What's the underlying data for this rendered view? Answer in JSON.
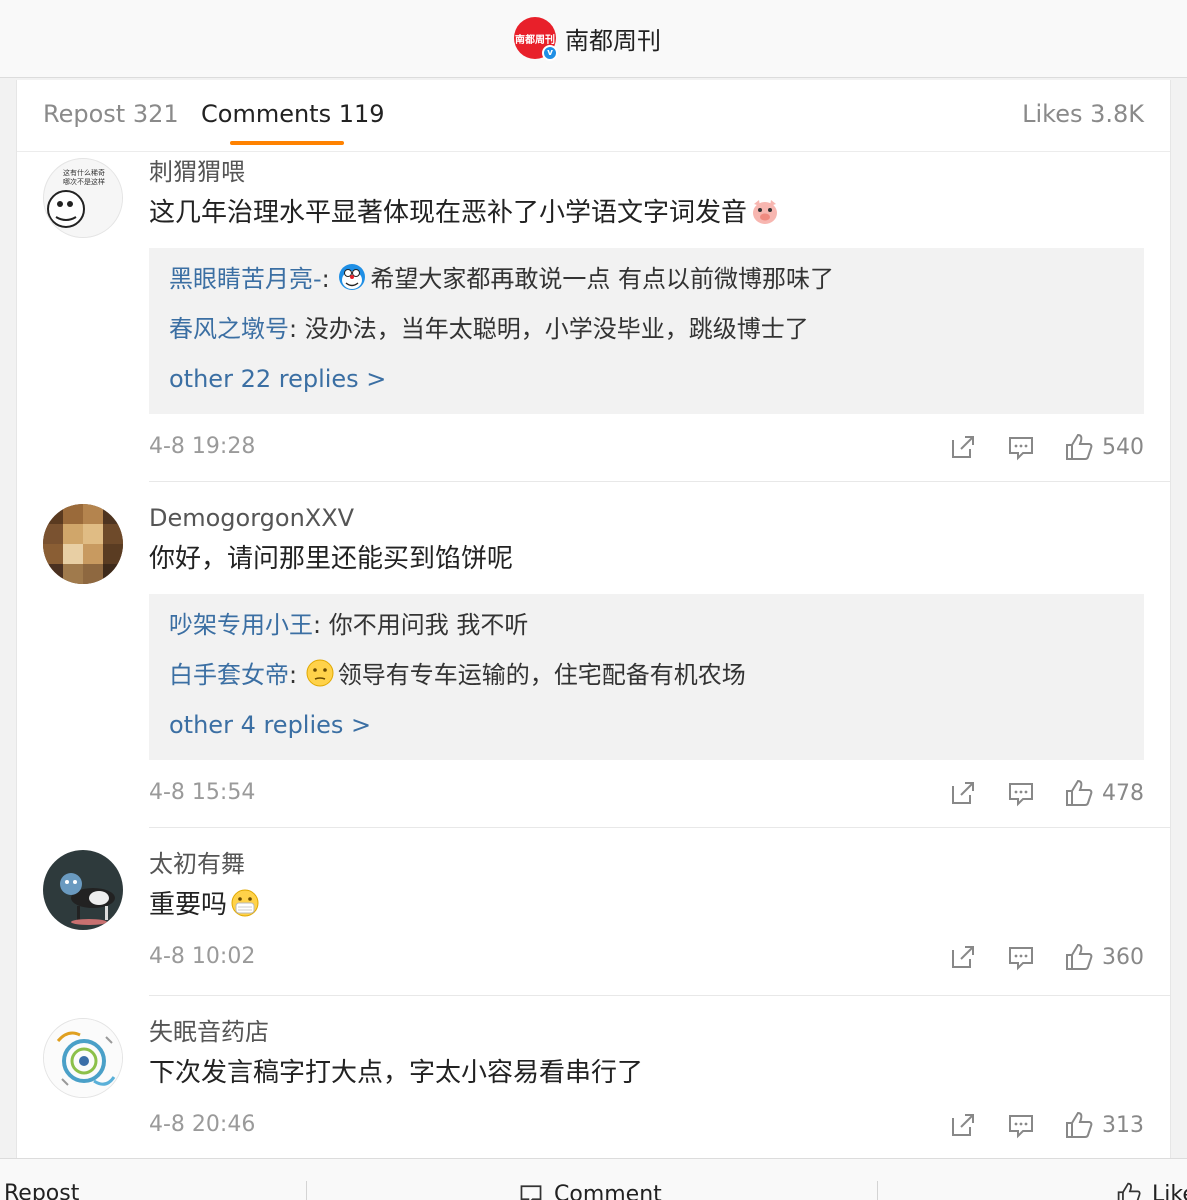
{
  "header": {
    "account_name": "南都周刊",
    "logo_text": "南都周刊"
  },
  "tabs": {
    "repost": "Repost 321",
    "comments": "Comments 119",
    "likes": "Likes 3.8K"
  },
  "comments": [
    {
      "username": "刺猬猬喂",
      "text": "这几年治理水平显著体现在恶补了小学语文字词发音",
      "replies": [
        {
          "user": "黑眼睛苦月亮-",
          "text": "希望大家都再敢说一点 有点以前微博那味了"
        },
        {
          "user": "春风之墩号",
          "text": "没办法，当年太聪明，小学没毕业，跳级博士了"
        }
      ],
      "more_replies": "other 22 replies >",
      "time": "4-8 19:28",
      "likes": "540"
    },
    {
      "username": "DemogorgonXXV",
      "text": "你好，请问那里还能买到馅饼呢",
      "replies": [
        {
          "user": "吵架专用小王",
          "text": "你不用问我 我不听"
        },
        {
          "user": "白手套女帝",
          "text": "领导有专车运输的，住宅配备有机农场"
        }
      ],
      "more_replies": "other 4 replies >",
      "time": "4-8 15:54",
      "likes": "478"
    },
    {
      "username": "太初有舞",
      "text": "重要吗",
      "time": "4-8 10:02",
      "likes": "360"
    },
    {
      "username": "失眠音药店",
      "text": "下次发言稿字打大点，字太小容易看串行了",
      "time": "4-8 20:46",
      "likes": "313"
    }
  ],
  "bottom_bar": {
    "repost": "Repost",
    "comment": "Comment",
    "like": "Like"
  },
  "colors": {
    "accent": "#ff8200",
    "link": "#3b6fa3",
    "brand": "#e8202a"
  }
}
